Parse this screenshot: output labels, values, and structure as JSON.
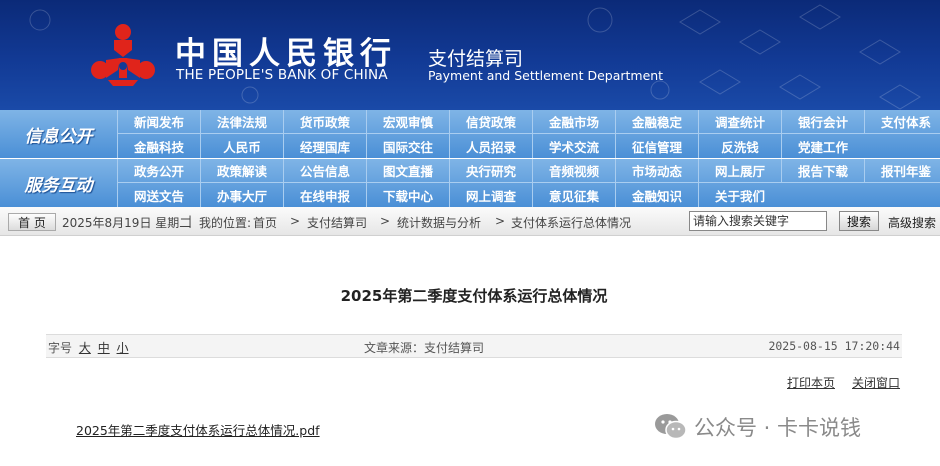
{
  "header": {
    "bank_name_cn": "中国人民银行",
    "bank_name_en": "THE PEOPLE'S BANK OF CHINA",
    "dept_cn": "支付结算司",
    "dept_en": "Payment and Settlement Department",
    "colors": {
      "banner": "#123a95",
      "emblem": "#e0241b"
    }
  },
  "nav": {
    "row1_label": "信息公开",
    "row2_label": "服务互动",
    "row1_items": [
      "新闻发布",
      "法律法规",
      "货币政策",
      "宏观审慎",
      "信贷政策",
      "金融市场",
      "金融稳定",
      "调查统计",
      "银行会计",
      "支付体系",
      "金融科技",
      "人民币",
      "经理国库",
      "国际交往",
      "人员招录",
      "学术交流",
      "征信管理",
      "反洗钱",
      "党建工作"
    ],
    "row2_items": [
      "政务公开",
      "政策解读",
      "公告信息",
      "图文直播",
      "央行研究",
      "音频视频",
      "市场动态",
      "网上展厅",
      "报告下载",
      "报刊年鉴",
      "网送文告",
      "办事大厅",
      "在线申报",
      "下载中心",
      "网上调查",
      "意见征集",
      "金融知识",
      "关于我们"
    ]
  },
  "breadcrumb": {
    "home_label": "首 页",
    "date": "2025年8月19日 星期二",
    "location_label": "我的位置:",
    "items": [
      "首页",
      "支付结算司",
      "统计数据与分析",
      "支付体系运行总体情况"
    ],
    "separator": ">",
    "divider": "|"
  },
  "search": {
    "placeholder": "请输入搜索关键字",
    "button_label": "搜索",
    "advanced_label": "高级搜索"
  },
  "article": {
    "title": "2025年第二季度支付体系运行总体情况",
    "font_size_label": "字号",
    "font_sizes": [
      "大",
      "中",
      "小"
    ],
    "source": "文章来源：支付结算司",
    "date": "2025-08-15 17:20:44",
    "print_label": "打印本页",
    "close_label": "关闭窗口",
    "attachment": "2025年第二季度支付体系运行总体情况.pdf"
  },
  "watermark": {
    "text": "公众号 · 卡卡说钱",
    "icon": "wechat-icon"
  }
}
